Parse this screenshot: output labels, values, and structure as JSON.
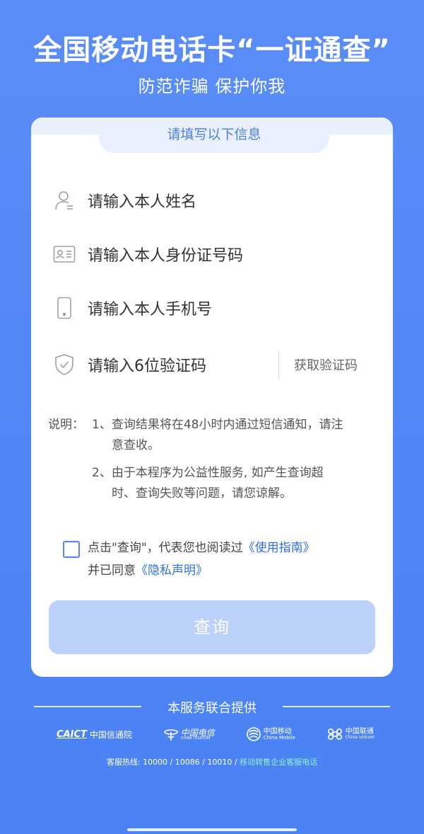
{
  "header": {
    "title": "全国移动电话卡“一证通查”",
    "subtitle": "防范诈骗 保护你我"
  },
  "form": {
    "section_title": "请填写以下信息",
    "name_placeholder": "请输入本人姓名",
    "id_placeholder": "请输入本人身份证号码",
    "phone_placeholder": "请输入本人手机号",
    "code_placeholder": "请输入6位验证码",
    "get_code_label": "获取验证码"
  },
  "notes": {
    "label": "说明：",
    "item1_line1": "1、查询结果将在48小时内通过短信通知，请注",
    "item1_line2": "意查收。",
    "item2_line1": "2、由于本程序为公益性服务, 如产生查询超",
    "item2_line2": "时、查询失败等问题，请您谅解。"
  },
  "agreement": {
    "text1": "点击\"查询\"，代表您也阅读过",
    "guide_link": "《使用指南》",
    "text2": "并已同意",
    "privacy_link": "《隐私声明》"
  },
  "query_button": "查询",
  "footer": {
    "title": "本服务联合提供",
    "caict_abbr": "CAICT",
    "caict_name": "中国信通院",
    "telecom_name": "中国电信",
    "telecom_en": "CHINA TELECOM",
    "mobile_name": "中国移动",
    "mobile_en": "China Mobile",
    "unicom_name": "中国联通",
    "unicom_en": "China unicom",
    "hotline_prefix": "客服热线: 10000 / 10086 / 10010 /",
    "hotline_suffix": "移动转售企业客服电话"
  },
  "colors": {
    "background": "#4f86f5",
    "accent": "#2f6fe6",
    "button_disabled": "#bcd2fb"
  }
}
